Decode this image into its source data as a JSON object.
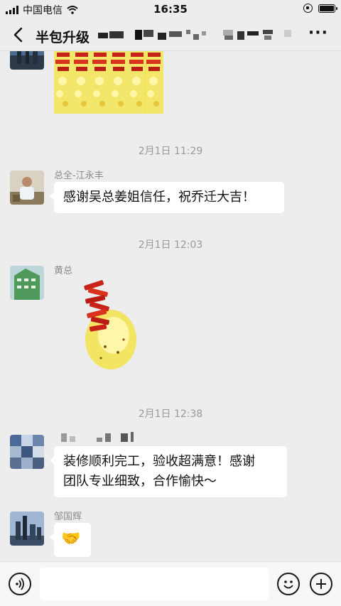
{
  "status_bar": {
    "carrier": "中国电信",
    "time": "16:35"
  },
  "nav": {
    "title": "半包升级",
    "back_icon": "chevron-left-icon",
    "more_label": "···"
  },
  "messages": {
    "ts1": "2月1日 11:29",
    "msg1_sender": "总全-江永丰",
    "msg1_text": "感谢吴总姜姐信任，祝乔迁大吉！",
    "ts2": "2月1日 12:03",
    "msg2_sender": "黄总",
    "ts3": "2月1日 12:38",
    "msg3_text_line1": "装修顺利完工，验收超满意！感谢",
    "msg3_text_line2": "团队专业细致，合作愉快～",
    "msg4_sender": "邹国辉",
    "msg4_emoji": "🤝"
  },
  "colors": {
    "background": "#ededed",
    "bubble": "#ffffff",
    "firecracker_red": "#c8231a",
    "firecracker_gold": "#f2e34a"
  }
}
